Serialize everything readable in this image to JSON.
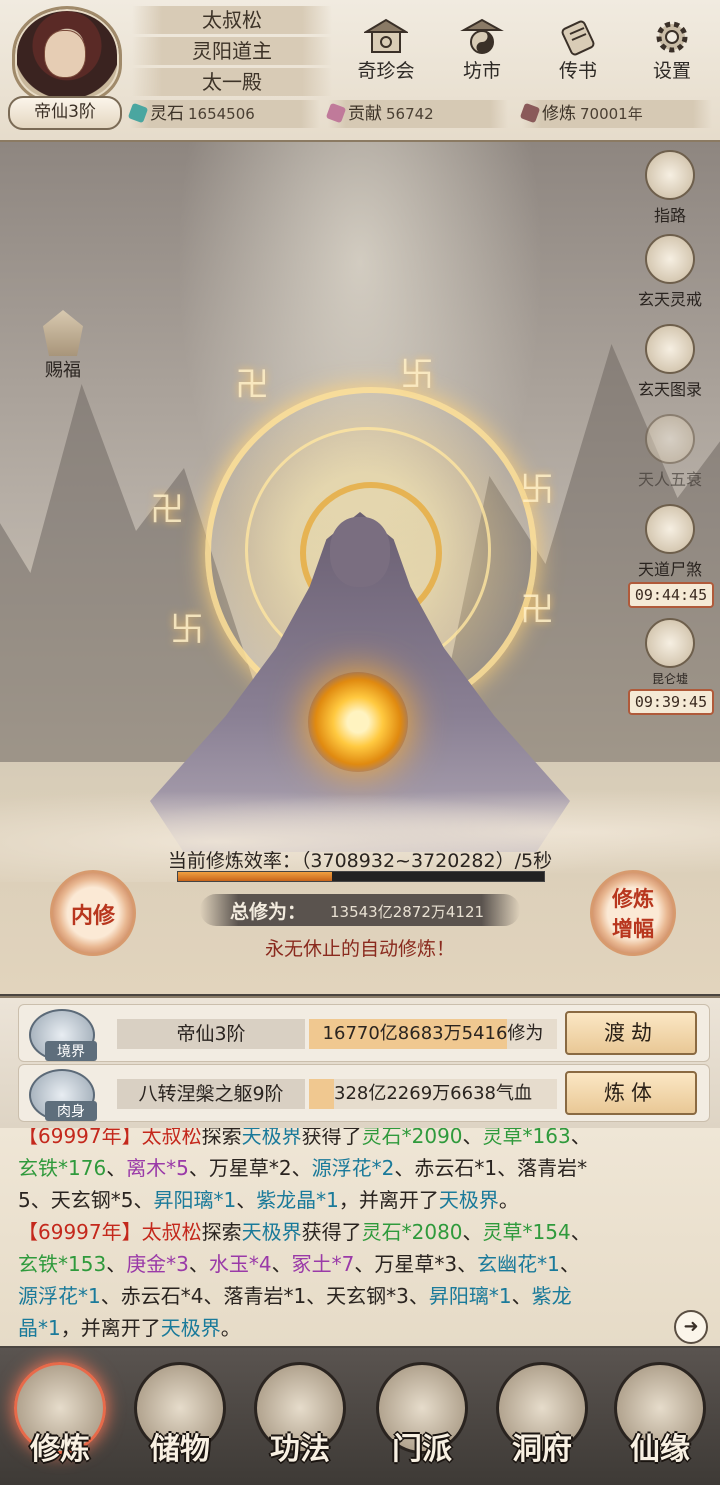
{
  "player": {
    "name": "太叔松",
    "title": "灵阳道主",
    "sect": "太一殿",
    "rank": "帝仙3阶"
  },
  "top_buttons": [
    {
      "label": "奇珍会",
      "icon": "treasure-pavilion-icon"
    },
    {
      "label": "坊市",
      "icon": "market-icon"
    },
    {
      "label": "传书",
      "icon": "scroll-letter-icon"
    },
    {
      "label": "设置",
      "icon": "gear-icon"
    }
  ],
  "resources": {
    "spirit_stone": {
      "label": "灵石",
      "value": "1654506",
      "color": "#4aa6a0"
    },
    "contribution": {
      "label": "贡献",
      "value": "56742",
      "color": "#c07a9a"
    },
    "cultivation_years": {
      "label": "修炼",
      "value": "70001年",
      "color": "#8a5a5a"
    }
  },
  "scene": {
    "blessing_label": "赐福",
    "side_buttons": [
      {
        "label": "指路",
        "icon": "guide-mountain-icon"
      },
      {
        "label": "玄天灵戒",
        "icon": "ring-icon"
      },
      {
        "label": "玄天图录",
        "icon": "scroll-icon"
      },
      {
        "label": "天人五衰",
        "icon": "buddha-icon"
      },
      {
        "label": "天道尸煞",
        "icon": "demon-mask-icon",
        "timer": "09:44:45"
      },
      {
        "label": "昆仑墟",
        "icon": "pavilion-icon",
        "timer": "09:39:45"
      }
    ],
    "efficiency_label": "当前修炼效率：",
    "efficiency_value": "（3708932~3720282）/5秒",
    "efficiency_progress": 0.42,
    "total_label": "总修为：",
    "total_value": "13543亿2872万4121",
    "auto_text": "永无休止的自动修炼！",
    "inner_btn": "内修",
    "boost_btn_line1": "修炼",
    "boost_btn_line2": "增幅"
  },
  "stats": {
    "realm": {
      "tag": "境界",
      "name": "帝仙3阶",
      "value": "16770亿8683万5416修为",
      "progress": 0.8,
      "button": "渡劫"
    },
    "body": {
      "tag": "肉身",
      "name": "八转涅槃之躯9阶",
      "value": "328亿2269万6638气血",
      "progress": 0.1,
      "button": "炼体"
    }
  },
  "log": {
    "line1": [
      "【69997年】",
      "太叔松",
      "探索",
      "天极界",
      "获得了",
      "灵石*2090",
      "、",
      "灵草*163",
      "、"
    ],
    "line2": [
      "玄铁*176",
      "、",
      "离木*5",
      "、万星草*2、",
      "源浮花*2",
      "、赤云石*1、落青岩*"
    ],
    "line3": [
      "5、天玄钢*5、",
      "昇阳璃*1",
      "、",
      "紫龙晶*1",
      "，并离开了",
      "天极界",
      "。"
    ],
    "line4": [
      "【69997年】",
      "太叔松",
      "探索",
      "天极界",
      "获得了",
      "灵石*2080",
      "、",
      "灵草*154",
      "、"
    ],
    "line5": [
      "玄铁*153",
      "、",
      "庚金*3",
      "、",
      "水玉*4",
      "、",
      "冢土*7",
      "、万星草*3、",
      "玄幽花*1",
      "、"
    ],
    "line6": [
      "源浮花*1",
      "、赤云石*4、落青岩*1、天玄钢*3、",
      "昇阳璃*1",
      "、",
      "紫龙"
    ],
    "line7": [
      "晶*1",
      "，并离开了",
      "天极界",
      "。"
    ]
  },
  "nav": [
    {
      "label": "修炼",
      "icon": "cultivator-icon"
    },
    {
      "label": "储物",
      "icon": "storage-bag-icon"
    },
    {
      "label": "功法",
      "icon": "technique-scroll-icon"
    },
    {
      "label": "门派",
      "icon": "sect-gate-icon"
    },
    {
      "label": "洞府",
      "icon": "cave-mountain-icon"
    },
    {
      "label": "仙缘",
      "icon": "yin-yang-icon"
    }
  ]
}
